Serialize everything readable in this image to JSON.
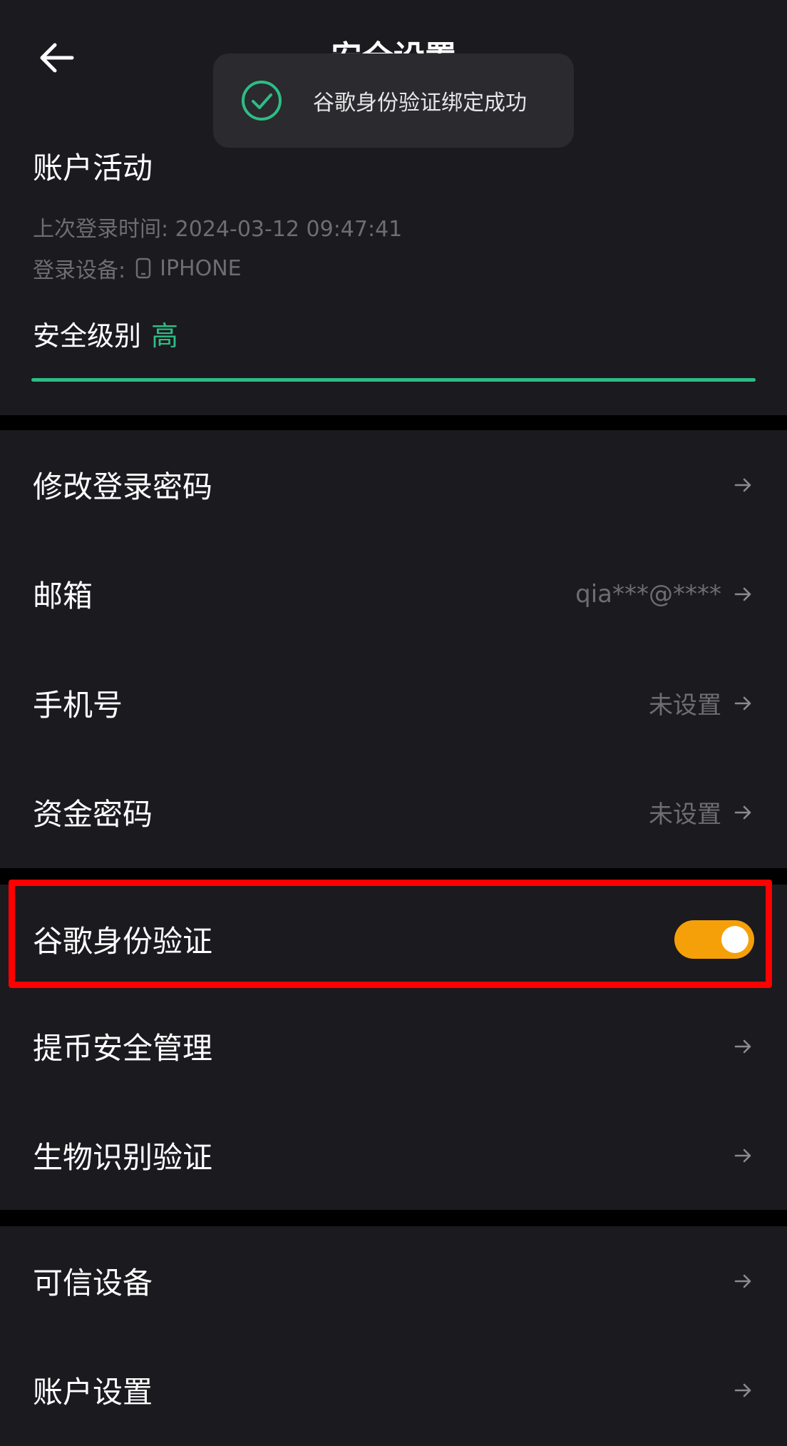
{
  "header": {
    "title": "安全设置",
    "back_icon": "arrow-left-icon"
  },
  "toast": {
    "icon": "check-circle-icon",
    "message": "谷歌身份验证绑定成功",
    "icon_color": "#2ebd85"
  },
  "account_activity": {
    "title": "账户活动",
    "last_login": "上次登录时间: 2024-03-12 09:47:41",
    "device_label": "登录设备:",
    "device_icon": "phone-icon",
    "device_name": "IPHONE",
    "security_level_label": "安全级别",
    "security_level_value": "高",
    "security_level_color": "#2ebd85"
  },
  "settings": [
    {
      "label": "修改登录密码",
      "value": ""
    },
    {
      "label": "邮箱",
      "value": "qia***@****"
    },
    {
      "label": "手机号",
      "value": "未设置"
    },
    {
      "label": "资金密码",
      "value": "未设置"
    }
  ],
  "settings2": [
    {
      "label": "谷歌身份验证",
      "toggle": true,
      "toggle_color": "#f5a009"
    },
    {
      "label": "提币安全管理",
      "value": ""
    },
    {
      "label": "生物识别验证",
      "value": ""
    }
  ],
  "settings3": [
    {
      "label": "可信设备",
      "value": ""
    },
    {
      "label": "账户设置",
      "value": ""
    }
  ],
  "colors": {
    "background": "#1b1a1f",
    "accent_green": "#2ebd85",
    "highlight_red": "#ff0000"
  }
}
